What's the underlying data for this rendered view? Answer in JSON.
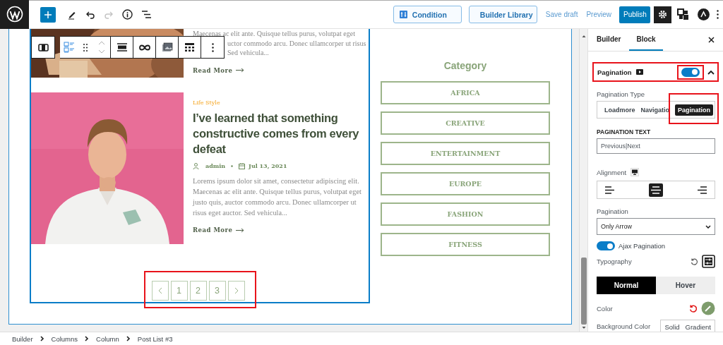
{
  "top_bar": {
    "buttons": [
      {
        "kind": "condition",
        "label": "Condition"
      },
      {
        "kind": "library",
        "label": "Builder Library"
      }
    ],
    "links": [
      "Save draft",
      "Preview"
    ],
    "publish": "Publish"
  },
  "posts": [
    {
      "kind": "partial",
      "lines": [
        "Maecenas ac elit ante. Quisque tellus purus, volutpat eget",
        "uctor commodo arcu. Donec ullamcorper ut risus",
        "Sed vehicula..."
      ],
      "read_more": "Read More"
    },
    {
      "kind": "full",
      "category": "Life Style",
      "title": "I’ve learned that something constructive comes from every defeat",
      "author": "admin",
      "date": "Jul 13, 2021",
      "excerpt": "Lorems ipsum dolor sit amet, consectetur adipiscing elit. Maecenas ac elit ante. Quisque tellus purus, volutpat eget justo quis, auctor commodo arcu. Donec ullamcorper ut risus eget auctor. Sed vehicula...",
      "read_more": "Read More"
    }
  ],
  "pagination": [
    "1",
    "2",
    "3"
  ],
  "category_widget": {
    "title": "Category",
    "items": [
      "AFRICA",
      "CREATIVE",
      "ENTERTAINMENT",
      "EUROPE",
      "FASHION",
      "FITNESS"
    ]
  },
  "sidebar": {
    "tabs": [
      {
        "label": "Builder",
        "selected": false
      },
      {
        "label": "Block",
        "selected": true
      }
    ],
    "panel": {
      "title": "Pagination",
      "on": true,
      "expanded": true
    },
    "pagination_type": {
      "label": "Pagination Type",
      "options": [
        {
          "label": "Loadmore",
          "selected": false
        },
        {
          "label": "Navigatio",
          "selected": false
        },
        {
          "label": "Pagination",
          "selected": true
        }
      ]
    },
    "pagination_text": {
      "label": "PAGINATION TEXT",
      "value": "Previous|Next"
    },
    "alignment": {
      "label": "Alignment",
      "options": [
        {
          "kind": "left",
          "selected": false
        },
        {
          "kind": "center",
          "selected": true
        },
        {
          "kind": "right",
          "selected": false
        }
      ]
    },
    "pagination_select": {
      "label": "Pagination",
      "value": "Only Arrow"
    },
    "ajax_pagination": {
      "label": "Ajax Pagination",
      "on": true
    },
    "typography": {
      "label": "Typography"
    },
    "state_tabs": [
      {
        "label": "Normal",
        "selected": true
      },
      {
        "label": "Hover",
        "selected": false
      }
    ],
    "color": {
      "label": "Color"
    },
    "background_color": {
      "label": "Background Color",
      "options": [
        "Solid",
        "Gradient"
      ]
    }
  },
  "breadcrumb": [
    "Builder",
    "Columns",
    "Column",
    "Post List #3"
  ]
}
